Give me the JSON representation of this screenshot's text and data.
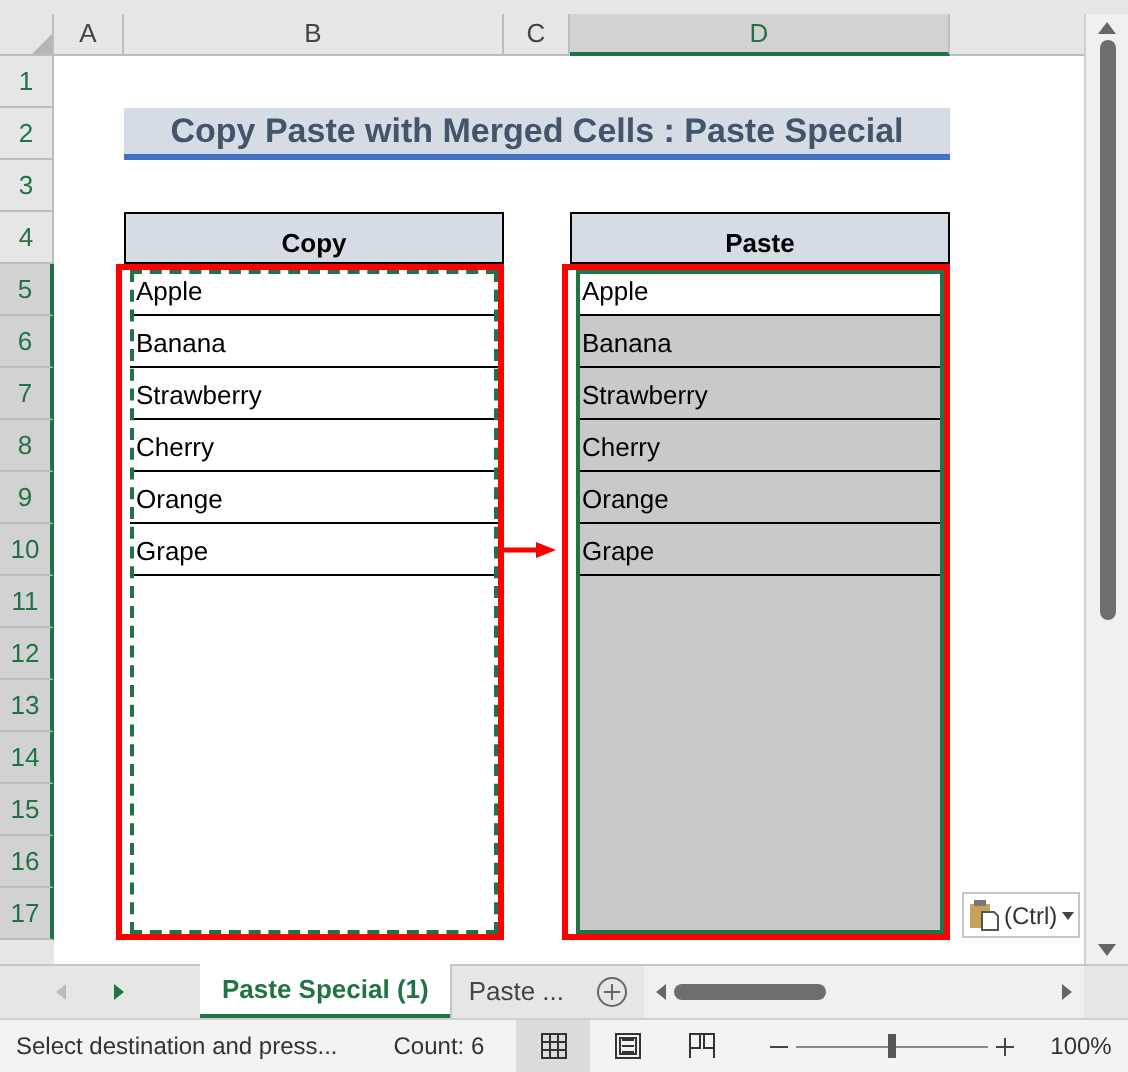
{
  "columns": [
    {
      "label": "A",
      "selected": false
    },
    {
      "label": "B",
      "selected": false
    },
    {
      "label": "C",
      "selected": false
    },
    {
      "label": "D",
      "selected": true
    }
  ],
  "rows": [
    {
      "label": "1",
      "selected": false
    },
    {
      "label": "2",
      "selected": false
    },
    {
      "label": "3",
      "selected": false
    },
    {
      "label": "4",
      "selected": false
    },
    {
      "label": "5",
      "selected": true
    },
    {
      "label": "6",
      "selected": true
    },
    {
      "label": "7",
      "selected": true
    },
    {
      "label": "8",
      "selected": true
    },
    {
      "label": "9",
      "selected": true
    },
    {
      "label": "10",
      "selected": true
    },
    {
      "label": "11",
      "selected": true
    },
    {
      "label": "12",
      "selected": true
    },
    {
      "label": "13",
      "selected": true
    },
    {
      "label": "14",
      "selected": true
    },
    {
      "label": "15",
      "selected": true
    },
    {
      "label": "16",
      "selected": true
    },
    {
      "label": "17",
      "selected": true
    }
  ],
  "title": "Copy Paste with Merged Cells : Paste Special",
  "copy": {
    "header": "Copy",
    "items": [
      "Apple",
      "Banana",
      "Strawberry",
      "Cherry",
      "Orange",
      "Grape"
    ]
  },
  "paste": {
    "header": "Paste",
    "items": [
      {
        "text": "Apple",
        "active": true
      },
      {
        "text": "Banana",
        "active": false
      },
      {
        "text": "Strawberry",
        "active": false
      },
      {
        "text": "Cherry",
        "active": false
      },
      {
        "text": "Orange",
        "active": false
      },
      {
        "text": "Grape",
        "active": false
      }
    ]
  },
  "paste_options": {
    "label": "(Ctrl)"
  },
  "sheet_tabs": [
    {
      "label": "Paste Special (1)",
      "selected": true
    },
    {
      "label": "Paste ...",
      "selected": false
    }
  ],
  "status_bar": {
    "message": "Select destination and press...",
    "count": "Count: 6",
    "views": [
      {
        "kind": "normal",
        "selected": true
      },
      {
        "kind": "page_layout",
        "selected": false
      },
      {
        "kind": "page_break",
        "selected": false
      }
    ],
    "zoom": {
      "level": 0.5
    },
    "zoom_label": "100%"
  }
}
